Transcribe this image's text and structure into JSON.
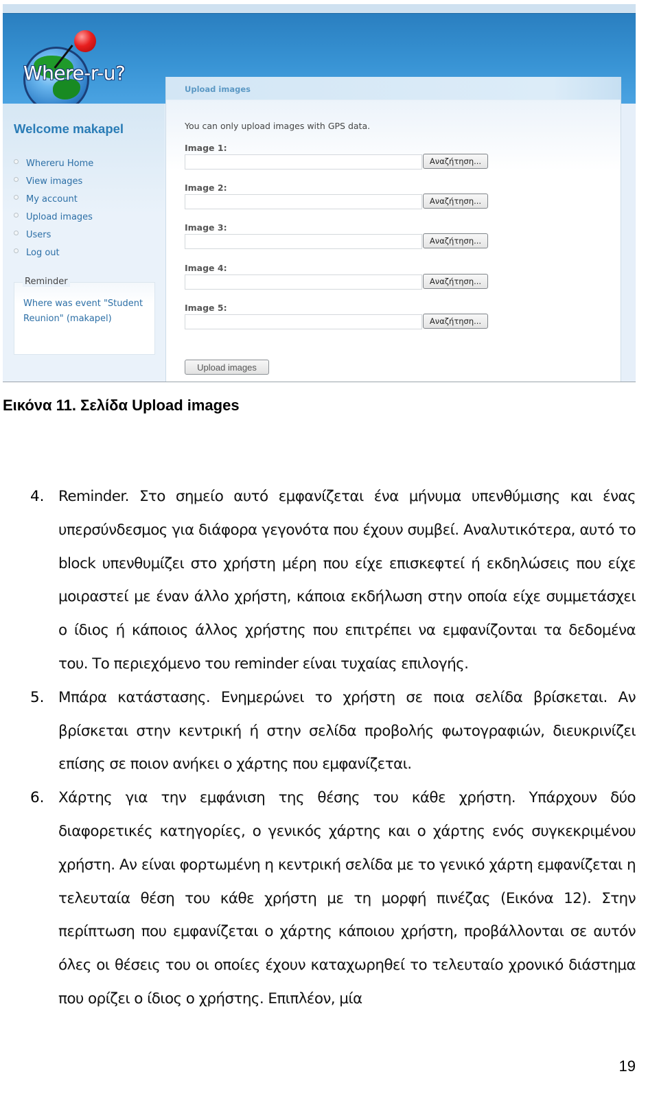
{
  "app": {
    "logo_text": "Where-r-u?",
    "welcome": "Welcome makapel",
    "nav": [
      {
        "label": "Whereru Home"
      },
      {
        "label": "View images"
      },
      {
        "label": "My account"
      },
      {
        "label": "Upload images"
      },
      {
        "label": "Users"
      },
      {
        "label": "Log out"
      }
    ],
    "reminder": {
      "title": "Reminder",
      "link_text": "Where was event \"Student Reunion\" (makapel)"
    },
    "panel": {
      "title": "Upload images",
      "note": "You can only upload images with GPS data.",
      "fields": [
        {
          "label": "Image 1:",
          "value": "",
          "browse_label": "Αναζήτηση..."
        },
        {
          "label": "Image 2:",
          "value": "",
          "browse_label": "Αναζήτηση..."
        },
        {
          "label": "Image 3:",
          "value": "",
          "browse_label": "Αναζήτηση..."
        },
        {
          "label": "Image 4:",
          "value": "",
          "browse_label": "Αναζήτηση..."
        },
        {
          "label": "Image 5:",
          "value": "",
          "browse_label": "Αναζήτηση..."
        }
      ],
      "submit_label": "Upload images"
    },
    "colors": {
      "header_blue": "#3893d4",
      "link_blue": "#2c6fa6",
      "welcome_blue": "#2a7cb6",
      "panel_title": "#5b98c4"
    }
  },
  "document": {
    "caption": "Εικόνα 11. Σελίδα Upload images",
    "items": [
      {
        "number": "4.",
        "text": "Reminder. Στο σημείο αυτό εμφανίζεται ένα μήνυμα υπενθύμισης και ένας υπερσύνδεσμος για διάφορα γεγονότα που έχουν συμβεί. Αναλυτικότερα, αυτό το block υπενθυμίζει στο χρήστη μέρη που είχε επισκεφτεί ή εκδηλώσεις που είχε μοιραστεί με έναν άλλο χρήστη, κάποια εκδήλωση στην οποία είχε συμμετάσχει ο ίδιος ή κάποιος άλλος χρήστης που επιτρέπει να εμφανίζονται τα δεδομένα του. Το περιεχόμενο του reminder είναι τυχαίας επιλογής."
      },
      {
        "number": "5.",
        "text": "Μπάρα κατάστασης. Ενημερώνει το χρήστη σε ποια σελίδα βρίσκεται. Αν βρίσκεται στην κεντρική ή στην σελίδα προβολής φωτογραφιών, διευκρινίζει επίσης σε ποιον ανήκει ο χάρτης που εμφανίζεται."
      },
      {
        "number": "6.",
        "text": "Χάρτης για την εμφάνιση της θέσης του κάθε χρήστη. Υπάρχουν δύο διαφορετικές κατηγορίες, ο γενικός χάρτης και ο χάρτης ενός συγκεκριμένου χρήστη. Αν είναι φορτωμένη η κεντρική σελίδα με το γενικό χάρτη εμφανίζεται η τελευταία θέση του κάθε χρήστη με τη μορφή πινέζας (Εικόνα 12). Στην περίπτωση που εμφανίζεται ο χάρτης κάποιου χρήστη, προβάλλονται σε αυτόν όλες οι θέσεις του οι οποίες έχουν καταχωρηθεί το τελευταίο χρονικό διάστημα που ορίζει ο ίδιος ο χρήστης. Επιπλέον, μία"
      }
    ],
    "page_number": "19"
  }
}
